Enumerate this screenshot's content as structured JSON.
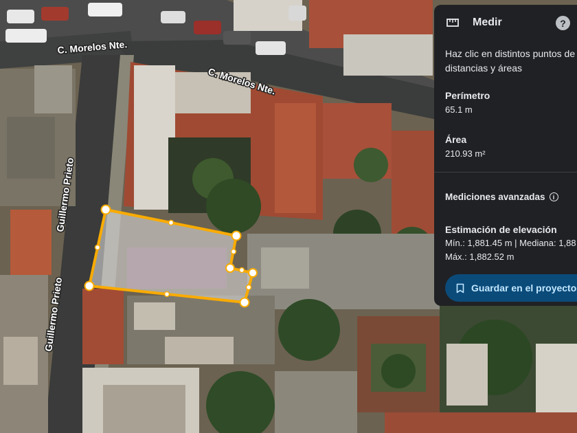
{
  "map": {
    "streets": [
      {
        "id": "morelos-1",
        "label": "C. Morelos Nte."
      },
      {
        "id": "morelos-2",
        "label": "C. Morelos Nte."
      },
      {
        "id": "prieto-1",
        "label": "Guillermo Prieto"
      },
      {
        "id": "prieto-2",
        "label": "Guillermo Prieto"
      }
    ],
    "measure_color": "#f9ab00"
  },
  "panel": {
    "title": "Medir",
    "ruler_icon": "ruler-icon",
    "help_icon": "help-icon",
    "help_glyph": "?",
    "instruction_line1": "Haz clic en distintos puntos de",
    "instruction_line2": "distancias y áreas",
    "perimeter_label": "Perímetro",
    "perimeter_value": "65.1 m",
    "area_label": "Área",
    "area_value": "210.93 m²",
    "advanced_label": "Mediciones avanzadas",
    "info_icon": "info-icon",
    "elevation_label": "Estimación de elevación",
    "elevation_line1": "Mín.: 1,881.45 m | Mediana: 1,88",
    "elevation_line2": "Máx.: 1,882.52 m",
    "save_label": "Guardar en el proyecto",
    "bookmark_icon": "bookmark-icon",
    "background": "#202124",
    "button_color": "#0b4b7a"
  }
}
